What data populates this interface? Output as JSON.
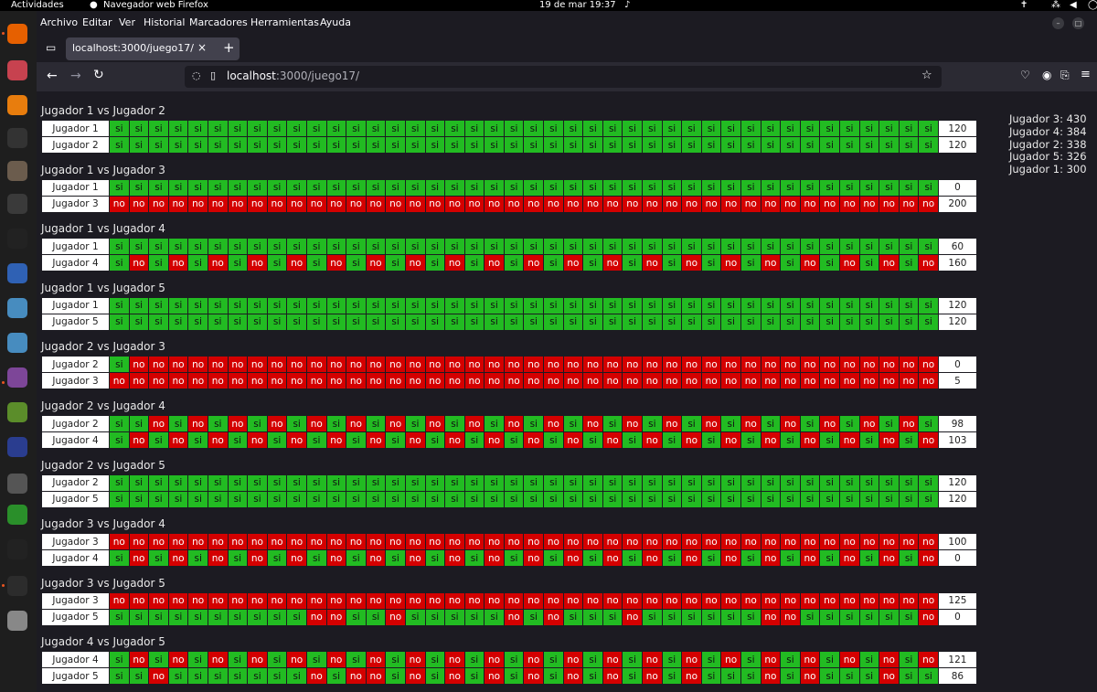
{
  "topbar": {
    "activities": "Actividades",
    "app": "Navegador web Firefox",
    "clock": "19 de mar  19:37"
  },
  "menu": {
    "archivo": "Archivo",
    "editar": "Editar",
    "ver": "Ver",
    "historial": "Historial",
    "marcadores": "Marcadores",
    "herramientas": "Herramientas",
    "ayuda": "Ayuda"
  },
  "tab": {
    "title": "localhost:3000/juego17/",
    "close": "×",
    "new": "+"
  },
  "url": {
    "host": "localhost",
    "path": ":3000/juego17/"
  },
  "dock": [
    {
      "name": "firefox-icon",
      "color": "#e66000"
    },
    {
      "name": "files-icon",
      "color": "#c7424f"
    },
    {
      "name": "blender-icon",
      "color": "#e87d0d"
    },
    {
      "name": "inkscape-icon",
      "color": "#333333"
    },
    {
      "name": "gimp-icon",
      "color": "#6b5c4d"
    },
    {
      "name": "vscode-icon",
      "color": "#3a3a3a"
    },
    {
      "name": "seq24-icon",
      "color": "#222222"
    },
    {
      "name": "virtualbox-icon",
      "color": "#2f61b4"
    },
    {
      "name": "godot-icon",
      "color": "#478cbf"
    },
    {
      "name": "godot-engine-icon",
      "color": "#478cbf"
    },
    {
      "name": "tor-icon",
      "color": "#7d4698"
    },
    {
      "name": "minetest-icon",
      "color": "#5b8d2a"
    },
    {
      "name": "inkscape-triangle-icon",
      "color": "#2a3d8f"
    },
    {
      "name": "vim-icon",
      "color": "#555555"
    },
    {
      "name": "circuit-icon",
      "color": "#2a8f2a"
    },
    {
      "name": "linux-icon",
      "color": "#222222"
    },
    {
      "name": "terminal-icon",
      "color": "#2c2c2c"
    },
    {
      "name": "disk-icon",
      "color": "#888888"
    },
    {
      "name": "apps-grid-icon",
      "color": "#1e1e1e"
    }
  ],
  "matches": [
    {
      "title": "Jugador 1 vs Jugador 2",
      "rows": [
        {
          "name": "Jugador 1",
          "seq": "SSSSSSSSSSSSSSSSSSSSSSSSSSSSSSSSSSSSSSSSSS",
          "score": "120"
        },
        {
          "name": "Jugador 2",
          "seq": "SSSSSSSSSSSSSSSSSSSSSSSSSSSSSSSSSSSSSSSSSS",
          "score": "120"
        }
      ]
    },
    {
      "title": "Jugador 1 vs Jugador 3",
      "rows": [
        {
          "name": "Jugador 1",
          "seq": "SSSSSSSSSSSSSSSSSSSSSSSSSSSSSSSSSSSSSSSSSS",
          "score": "0"
        },
        {
          "name": "Jugador 3",
          "seq": "NNNNNNNNNNNNNNNNNNNNNNNNNNNNNNNNNNNNNNNNNN",
          "score": "200"
        }
      ]
    },
    {
      "title": "Jugador 1 vs Jugador 4",
      "rows": [
        {
          "name": "Jugador 1",
          "seq": "SSSSSSSSSSSSSSSSSSSSSSSSSSSSSSSSSSSSSSSSSS",
          "score": "60"
        },
        {
          "name": "Jugador 4",
          "seq": "SNSNSNSNSNSNSNSNSNSNSNSNSNSNSNSNSNSNSNSNSN",
          "score": "160"
        }
      ]
    },
    {
      "title": "Jugador 1 vs Jugador 5",
      "rows": [
        {
          "name": "Jugador 1",
          "seq": "SSSSSSSSSSSSSSSSSSSSSSSSSSSSSSSSSSSSSSSSSS",
          "score": "120"
        },
        {
          "name": "Jugador 5",
          "seq": "SSSSSSSSSSSSSSSSSSSSSSSSSSSSSSSSSSSSSSSSSS",
          "score": "120"
        }
      ]
    },
    {
      "title": "Jugador 2 vs Jugador 3",
      "rows": [
        {
          "name": "Jugador 2",
          "seq": "SNNNNNNNNNNNNNNNNNNNNNNNNNNNNNNNNNNNNNNNNN",
          "score": "0"
        },
        {
          "name": "Jugador 3",
          "seq": "NNNNNNNNNNNNNNNNNNNNNNNNNNNNNNNNNNNNNNNNNN",
          "score": "5"
        }
      ]
    },
    {
      "title": "Jugador 2 vs Jugador 4",
      "rows": [
        {
          "name": "Jugador 2",
          "seq": "SSNSNSNSNSNSNSNSNSNSNSNSNSNSNSNSNSNSNSNSNS",
          "score": "98"
        },
        {
          "name": "Jugador 4",
          "seq": "SNSNSNSNSNSNSNSNSNSNSNSNSNSNSNSNSNSNSNSNSN",
          "score": "103"
        }
      ]
    },
    {
      "title": "Jugador 2 vs Jugador 5",
      "rows": [
        {
          "name": "Jugador 2",
          "seq": "SSSSSSSSSSSSSSSSSSSSSSSSSSSSSSSSSSSSSSSSSS",
          "score": "120"
        },
        {
          "name": "Jugador 5",
          "seq": "SSSSSSSSSSSSSSSSSSSSSSSSSSSSSSSSSSSSSSSSSS",
          "score": "120"
        }
      ]
    },
    {
      "title": "Jugador 3 vs Jugador 4",
      "rows": [
        {
          "name": "Jugador 3",
          "seq": "NNNNNNNNNNNNNNNNNNNNNNNNNNNNNNNNNNNNNNNNNN",
          "score": "100"
        },
        {
          "name": "Jugador 4",
          "seq": "SNSNSNSNSNSNSNSNSNSNSNSNSNSNSNSNSNSNSNSNSN",
          "score": "0"
        }
      ]
    },
    {
      "title": "Jugador 3 vs Jugador 5",
      "rows": [
        {
          "name": "Jugador 3",
          "seq": "NNNNNNNNNNNNNNNNNNNNNNNNNNNNNNNNNNNNNNNNNN",
          "score": "125"
        },
        {
          "name": "Jugador 5",
          "seq": "SSSSSSSSSSNNSSNSSSSSNSNSSSNSSSSSSNNSSSSSSN",
          "score": "0"
        }
      ]
    },
    {
      "title": "Jugador 4 vs Jugador 5",
      "rows": [
        {
          "name": "Jugador 4",
          "seq": "SNSNSNSNSNSNSNSNSNSNSNSNSNSNSNSNSNSNSNSNSN",
          "score": "121"
        },
        {
          "name": "Jugador 5",
          "seq": "SSNSSSSSSSNSNNSNSNSNSNSNSNSNSNSSSNSNSSSNSS",
          "score": "86"
        }
      ]
    }
  ],
  "ranking": [
    "Jugador 3: 430",
    "Jugador 4: 384",
    "Jugador 2: 338",
    "Jugador 5: 326",
    "Jugador 1: 300"
  ],
  "labels": {
    "si": "si",
    "no": "no"
  }
}
